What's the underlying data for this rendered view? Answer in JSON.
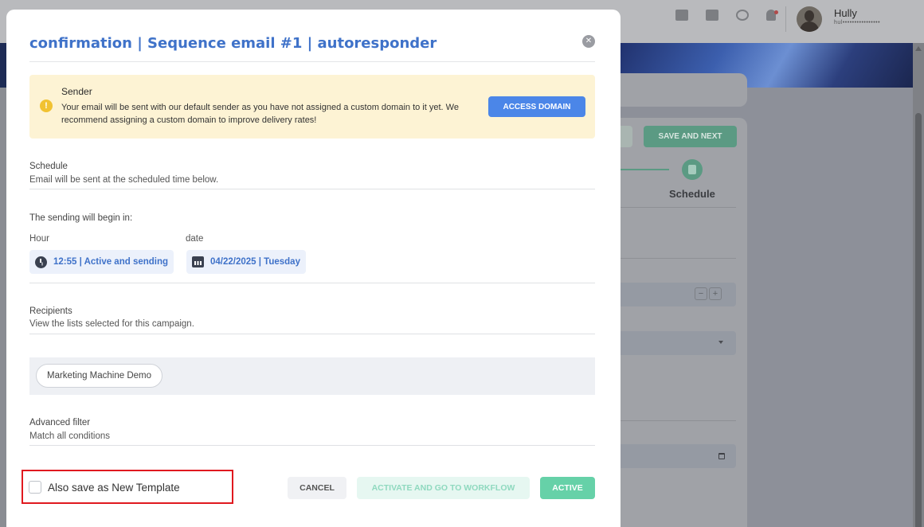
{
  "header": {
    "user_name": "Hully",
    "user_email": "hul••••••••••••••••"
  },
  "background": {
    "save_next_label": "SAVE AND NEXT",
    "step_label": "Schedule",
    "stepper_minus": "−",
    "stepper_plus": "+"
  },
  "modal": {
    "title": "confirmation | Sequence email #1 | autoresponder",
    "close_glyph": "✕",
    "notice": {
      "title": "Sender",
      "icon_glyph": "!",
      "text": "Your email will be sent with our default sender as you have not assigned a custom domain to it yet. We recommend assigning a custom domain to improve delivery rates!",
      "button": "ACCESS DOMAIN"
    },
    "schedule": {
      "label": "Schedule",
      "subtitle": "Email will be sent at the scheduled time below.",
      "begin_label": "The sending will begin in:",
      "hour_label": "Hour",
      "date_label": "date",
      "hour_value": "12:55 | Active and sending",
      "date_value": "04/22/2025 | Tuesday"
    },
    "recipients": {
      "label": "Recipients",
      "subtitle": "View the lists selected for this campaign.",
      "lists": [
        "Marketing Machine Demo"
      ]
    },
    "advanced_filter": {
      "label": "Advanced filter",
      "subtitle": "Match all conditions"
    },
    "footer": {
      "checkbox_label": "Also save as New Template",
      "cancel": "CANCEL",
      "activate_workflow": "ACTIVATE AND GO TO WORKFLOW",
      "active": "ACTIVE"
    }
  },
  "colors": {
    "title_blue": "#3f72c9",
    "primary_button": "#4b86e8",
    "success": "#66d1a8",
    "notice_bg": "#fdf3d4",
    "warning": "#f1c232",
    "highlight": "#e0191f"
  }
}
